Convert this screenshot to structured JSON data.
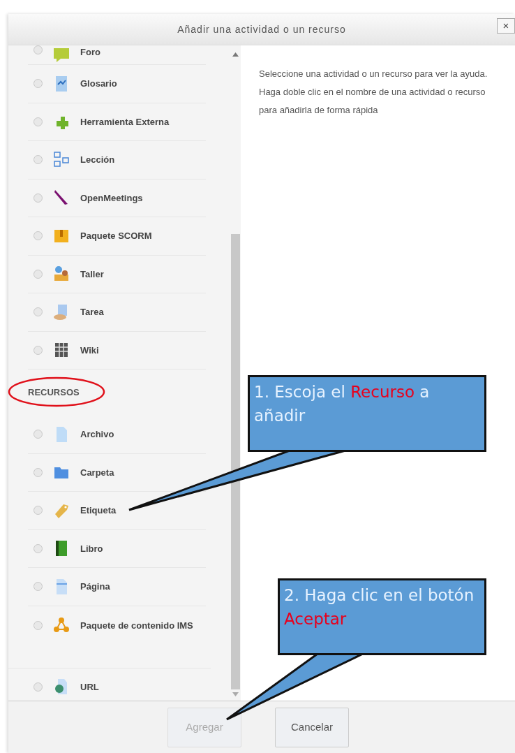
{
  "dialog": {
    "title": "Añadir una actividad o un recurso",
    "close": "×"
  },
  "activities": {
    "items": [
      {
        "label": "Foro",
        "selected": false
      },
      {
        "label": "Glosario",
        "selected": false
      },
      {
        "label": "Herramienta Externa",
        "selected": false
      },
      {
        "label": "Lección",
        "selected": false
      },
      {
        "label": "OpenMeetings",
        "selected": false
      },
      {
        "label": "Paquete SCORM",
        "selected": false
      },
      {
        "label": "Taller",
        "selected": false
      },
      {
        "label": "Tarea",
        "selected": false
      },
      {
        "label": "Wiki",
        "selected": false
      }
    ]
  },
  "resources": {
    "heading": "RECURSOS",
    "items": [
      {
        "label": "Archivo",
        "selected": false
      },
      {
        "label": "Carpeta",
        "selected": false
      },
      {
        "label": "Etiqueta",
        "selected": false
      },
      {
        "label": "Libro",
        "selected": false
      },
      {
        "label": "Página",
        "selected": false
      },
      {
        "label": "Paquete de contenido IMS",
        "selected": false
      },
      {
        "label": "URL",
        "selected": false
      }
    ]
  },
  "help_text": "Seleccione una actividad o un recurso para ver la ayuda. Haga doble clic en el nombre de una actividad o recurso para añadirla de forma rápida",
  "callouts": [
    {
      "segments": [
        {
          "text": "1. Escoja el ",
          "highlight": false
        },
        {
          "text": "Recurso",
          "highlight": true
        },
        {
          "text": " a añadir",
          "highlight": false
        }
      ]
    },
    {
      "segments": [
        {
          "text": "2. Haga clic en el botón ",
          "highlight": false
        },
        {
          "text": "Aceptar",
          "highlight": true
        }
      ]
    }
  ],
  "buttons": [
    {
      "label": "Agregar",
      "disabled": true
    },
    {
      "label": "Cancelar",
      "disabled": false
    }
  ]
}
